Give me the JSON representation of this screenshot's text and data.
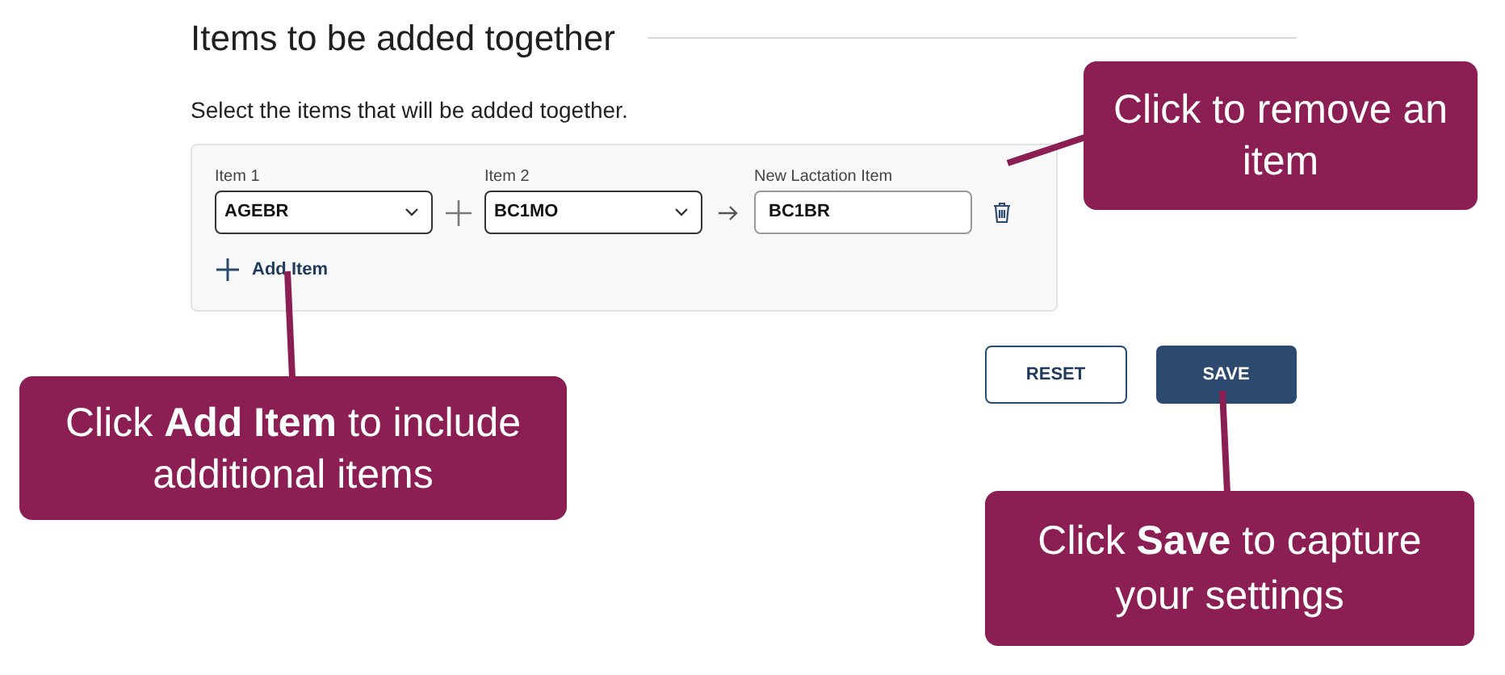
{
  "section": {
    "title": "Items to be added together",
    "instructions": "Select the items that will be added together."
  },
  "item_row": {
    "fields": [
      {
        "kind": "select",
        "label": "Item 1",
        "value": "AGEBR"
      },
      {
        "kind": "select",
        "label": "Item 2",
        "value": "BC1MO"
      },
      {
        "kind": "text",
        "label": "New Lactation Item",
        "value": "BC1BR"
      }
    ]
  },
  "add_item": {
    "label": "Add Item"
  },
  "buttons": [
    {
      "kind": "outline",
      "label": "RESET"
    },
    {
      "kind": "filled",
      "label": "SAVE"
    }
  ],
  "callouts": [
    {
      "text": "Click to remove an item"
    },
    {
      "text": "Click **Add Item** to include additional items"
    },
    {
      "text": "Click **Save** to capture your settings"
    }
  ]
}
